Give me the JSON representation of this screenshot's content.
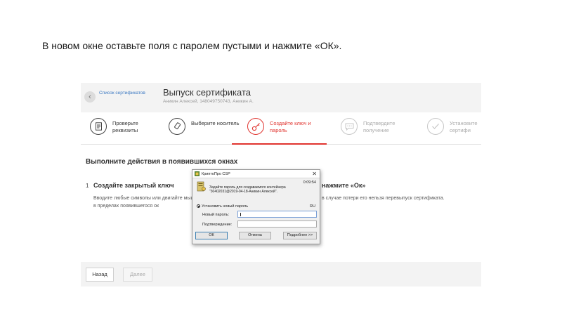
{
  "caption": "В новом окне оставьте поля с паролем пустыми и нажмите «ОК».",
  "header": {
    "back_label": "Список сертификатов",
    "title": "Выпуск сертификата",
    "subtitle": "Аникин Алексей, 148049750743, Аникин А."
  },
  "steps": [
    {
      "label": "Проверьте реквизиты",
      "icon": "document-icon",
      "state": "done"
    },
    {
      "label": "Выберите носитель",
      "icon": "usb-token-icon",
      "state": "done"
    },
    {
      "label": "Создайте ключ и пароль",
      "icon": "key-icon",
      "state": "active"
    },
    {
      "label": "Подтвердите получение",
      "icon": "chat-icon",
      "state": "pending"
    },
    {
      "label": "Установите сертифи",
      "icon": "check-circle-icon",
      "state": "pending"
    }
  ],
  "main": {
    "section_title": "Выполните действия в появившихся окнах",
    "task1": {
      "number": "1",
      "title": "Создайте закрытый ключ",
      "desc": "Вводите любые символы или двигайте мышкой в пределах появившегося ок"
    },
    "task2": {
      "title": "нажмите «Ок»",
      "desc": "в случае потери его нельзя перевыпуск сертификата."
    }
  },
  "footer": {
    "back_button": "Назад",
    "next_button": "Далее"
  },
  "dialog": {
    "title": "КриптоПро CSP",
    "close": "✕",
    "timer": "0:09:54",
    "message": "Задайте пароль для создаваемого контейнера \"30402031@2019-04-18-Аникин Алексей\".",
    "radio_label": "Установить новый пароль",
    "lang": "RU",
    "new_password_label": "Новый пароль:",
    "new_password_value": "",
    "confirm_label": "Подтверждение:",
    "confirm_value": "",
    "ok": "ОК",
    "cancel": "Отмена",
    "more": "Подробнее >>"
  },
  "colors": {
    "accent": "#e0342f",
    "link": "#3a78c2"
  }
}
